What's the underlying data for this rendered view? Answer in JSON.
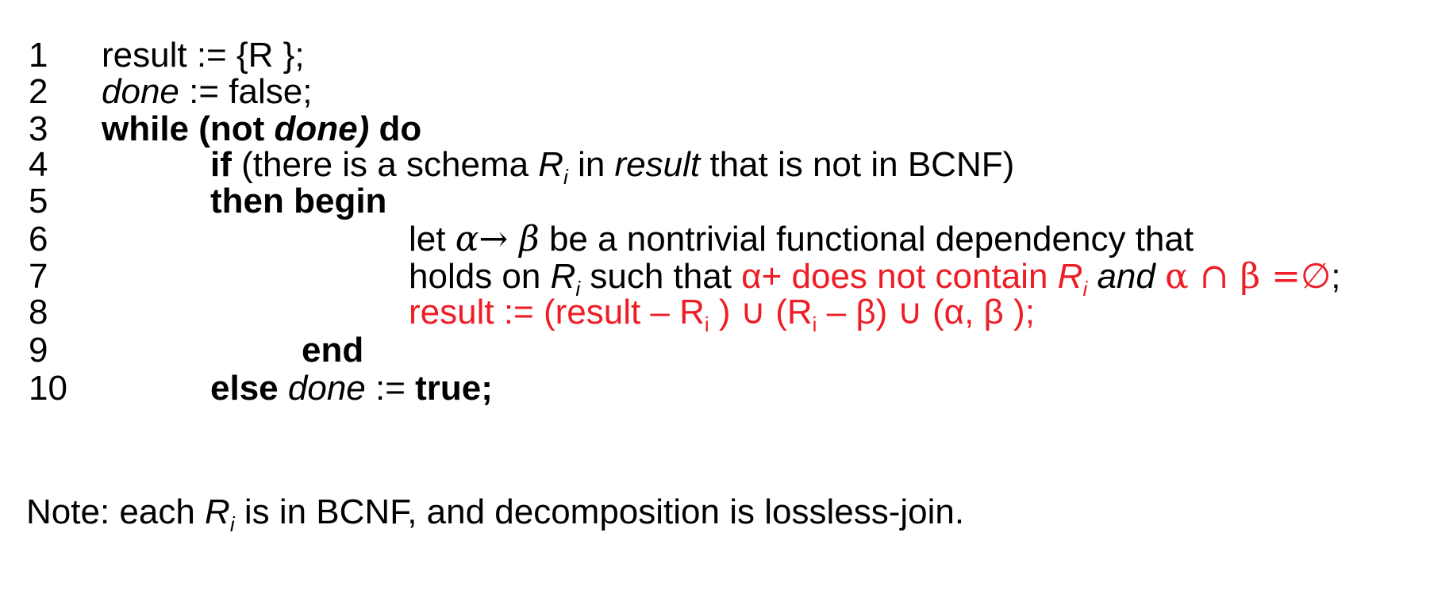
{
  "lines": [
    {
      "num": "1",
      "parts": [
        "result := {R };"
      ]
    },
    {
      "num": "2",
      "parts": [
        "done",
        " := false;"
      ]
    },
    {
      "num": "3",
      "parts": [
        "while (not ",
        "done)",
        " do"
      ]
    },
    {
      "num": "4",
      "parts": [
        "if",
        " (there is a schema ",
        "R",
        "i",
        " in ",
        "result",
        "  that is not in BCNF)"
      ]
    },
    {
      "num": "5",
      "parts": [
        "then begin"
      ]
    },
    {
      "num": "6",
      "parts": [
        "let ",
        "α→ β",
        "  be a nontrivial functional dependency that"
      ]
    },
    {
      "num": "7",
      "parts": [
        "holds on ",
        "R",
        "i",
        "  such that ",
        "α+ does not contain ",
        "R",
        "i",
        "  and ",
        "α ∩ β  =∅",
        ";"
      ]
    },
    {
      "num": "8",
      "parts": [
        "result := (result – R",
        "i",
        " ) ∪ (R",
        "i",
        " – β) ∪ (α, β );"
      ]
    },
    {
      "num": "9",
      "parts": [
        "end"
      ]
    },
    {
      "num": "10",
      "parts": [
        "else ",
        "done",
        " := ",
        "true;"
      ]
    }
  ],
  "note": {
    "parts": [
      "Note:  each ",
      "R",
      "i",
      " is in BCNF, and decomposition is lossless-join."
    ]
  },
  "colors": {
    "text": "#000000",
    "highlight": "#ee1c25",
    "background": "#ffffff"
  }
}
